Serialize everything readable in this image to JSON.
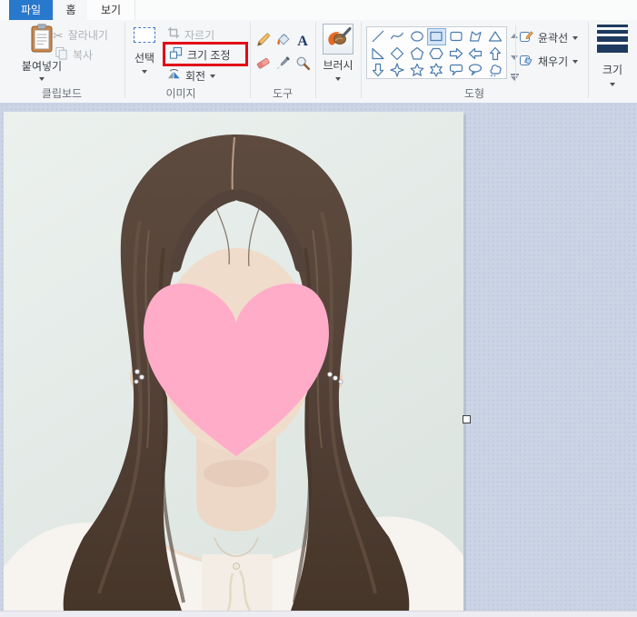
{
  "window": {
    "tabs": [
      "파일",
      "홈",
      "보기"
    ],
    "active_tab": "홈"
  },
  "ribbon": {
    "clipboard": {
      "label": "클립보드",
      "paste": "붙여넣기",
      "cut": "잘라내기",
      "copy": "복사"
    },
    "image": {
      "label": "이미지",
      "select": "선택",
      "crop": "자르기",
      "resize": "크기 조정",
      "rotate": "회전"
    },
    "tools": {
      "label": "도구",
      "items": [
        "pencil-icon",
        "fill-bucket-icon",
        "text-icon",
        "eraser-icon",
        "eyedropper-icon",
        "magnifier-icon"
      ]
    },
    "brushes": {
      "button": "브러시"
    },
    "shapes": {
      "label": "도형",
      "outline": "윤곽선",
      "fill": "채우기",
      "selected": "rectangle",
      "items": [
        "line",
        "curve",
        "ellipse",
        "rectangle",
        "rounded-rectangle",
        "polygon",
        "triangle",
        "right-triangle",
        "diamond",
        "pentagon",
        "hexagon",
        "arrow-right",
        "arrow-left",
        "arrow-up",
        "arrow-down",
        "star-4",
        "star-5",
        "star-6",
        "callout-rounded",
        "callout-oval",
        "callout-cloud"
      ]
    },
    "size": {
      "button": "크기"
    }
  },
  "annotation": {
    "highlighted_button": "크기 조정",
    "highlight_color": "#e20a16"
  },
  "canvas": {
    "description": "Portrait photo of a woman with long dark brown wavy hair wearing a white blazer; her face is covered by a large pink heart sticker.",
    "heart_color": "#ffacc9",
    "photo_bg_color": "#e9efeb",
    "hair_color": "#564439",
    "blazer_color": "#f7f4f0",
    "skin_color": "#eedbcb"
  },
  "colors": {
    "file_tab_blue": "#2878cd",
    "ribbon_bg": "#f5f6f7",
    "workspace_bg": "#cbd4e4",
    "shape_stroke": "#4a7cae",
    "icon_navy": "#1f3a5f",
    "disabled_text": "#aeb3ba"
  }
}
